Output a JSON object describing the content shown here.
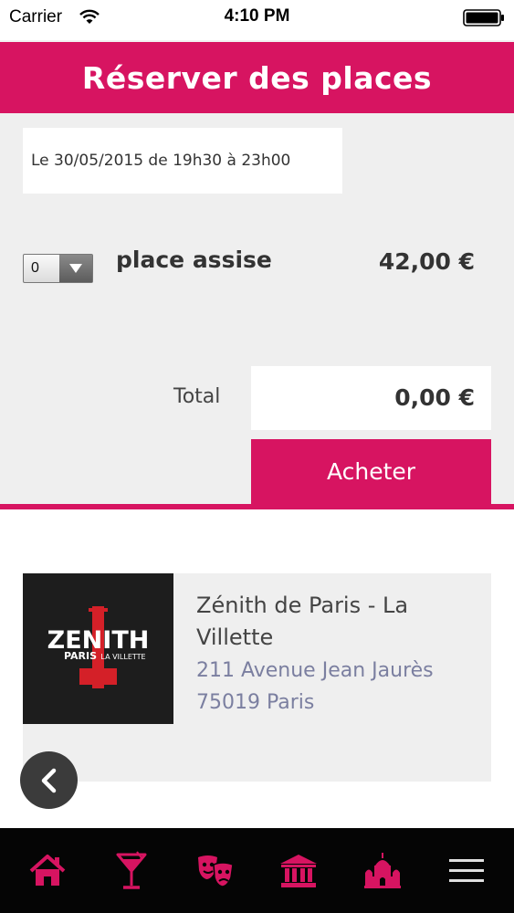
{
  "status_bar": {
    "carrier": "Carrier",
    "time": "4:10 PM"
  },
  "header": {
    "title": "Réserver des places"
  },
  "booking": {
    "date": "Le 30/05/2015 de 19h30 à 23h00",
    "quantity_selected": "0",
    "ticket_label": "place assise",
    "ticket_price": "42,00 €",
    "total_label": "Total",
    "total_value": "0,00 €",
    "buy_label": "Acheter"
  },
  "venue": {
    "name": "Zénith de Paris - La Villette",
    "address_line1": "211 Avenue Jean Jaurès",
    "address_line2": "75019 Paris",
    "logo_text_main": "ZENITH",
    "logo_text_sub_left": "PARIS",
    "logo_text_sub_right": "LA VILLETTE"
  },
  "tab_bar": {
    "items": [
      {
        "icon": "home-icon"
      },
      {
        "icon": "cocktail-icon"
      },
      {
        "icon": "theater-masks-icon"
      },
      {
        "icon": "museum-icon"
      },
      {
        "icon": "monument-icon"
      },
      {
        "icon": "menu-icon"
      }
    ]
  },
  "colors": {
    "accent": "#d71461",
    "panel_bg": "#efefef",
    "tab_bar_bg": "#050505"
  }
}
